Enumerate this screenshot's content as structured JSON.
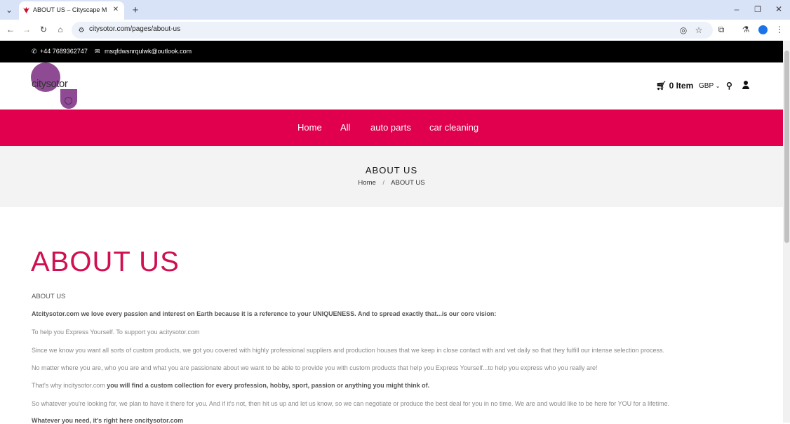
{
  "browser": {
    "tab_title": "ABOUT US – Cityscape Motors",
    "url": "citysotor.com/pages/about-us",
    "new_tab_glyph": "+",
    "close_tab_glyph": "✕"
  },
  "topbar": {
    "phone": "+44 7689362747",
    "email": "msqfdwsnrqulwk@outlook.com"
  },
  "header": {
    "logo_text": "citysotor",
    "cart_label": "0 Item",
    "currency": "GBP"
  },
  "nav": {
    "items": [
      "Home",
      "All",
      "auto parts",
      "car cleaning"
    ]
  },
  "banner": {
    "title": "ABOUT US",
    "crumb_home": "Home",
    "crumb_sep": "/",
    "crumb_current": "ABOUT US"
  },
  "content": {
    "title": "ABOUT US",
    "subtitle": "ABOUT US",
    "p1": "Atcitysotor.com we love every passion and interest on Earth because it is a reference to your UNIQUENESS. And to spread exactly that...is our core vision:",
    "p2": "To help you Express Yourself. To support you acitysotor.com",
    "p3": "Since we know you want all sorts of custom products, we got you covered with highly professional suppliers and production houses that we keep in close contact with and vet daily so that they fulfill our intense selection process.",
    "p4": "No matter where you are, who you are and what you are passionate about we want to be able to provide you with custom products that help you Express Yourself...to help you express who you really are!",
    "p5_a": "That's why incitysotor.com",
    "p5_b": "you will find a custom collection for every profession, hobby, sport, passion or anything you might think of.",
    "p6": "So whatever you're looking for, we plan to have it there for you. And if it's not, then hit us up and let us know, so we can negotiate or produce the best deal for you in no time. We are and would like to be here for YOU for a lifetime.",
    "p7": "Whatever you need, it's right here oncitysotor.com"
  },
  "colors": {
    "accent": "#e0004d",
    "title": "#d0104f",
    "logo": "#8e4b93"
  }
}
